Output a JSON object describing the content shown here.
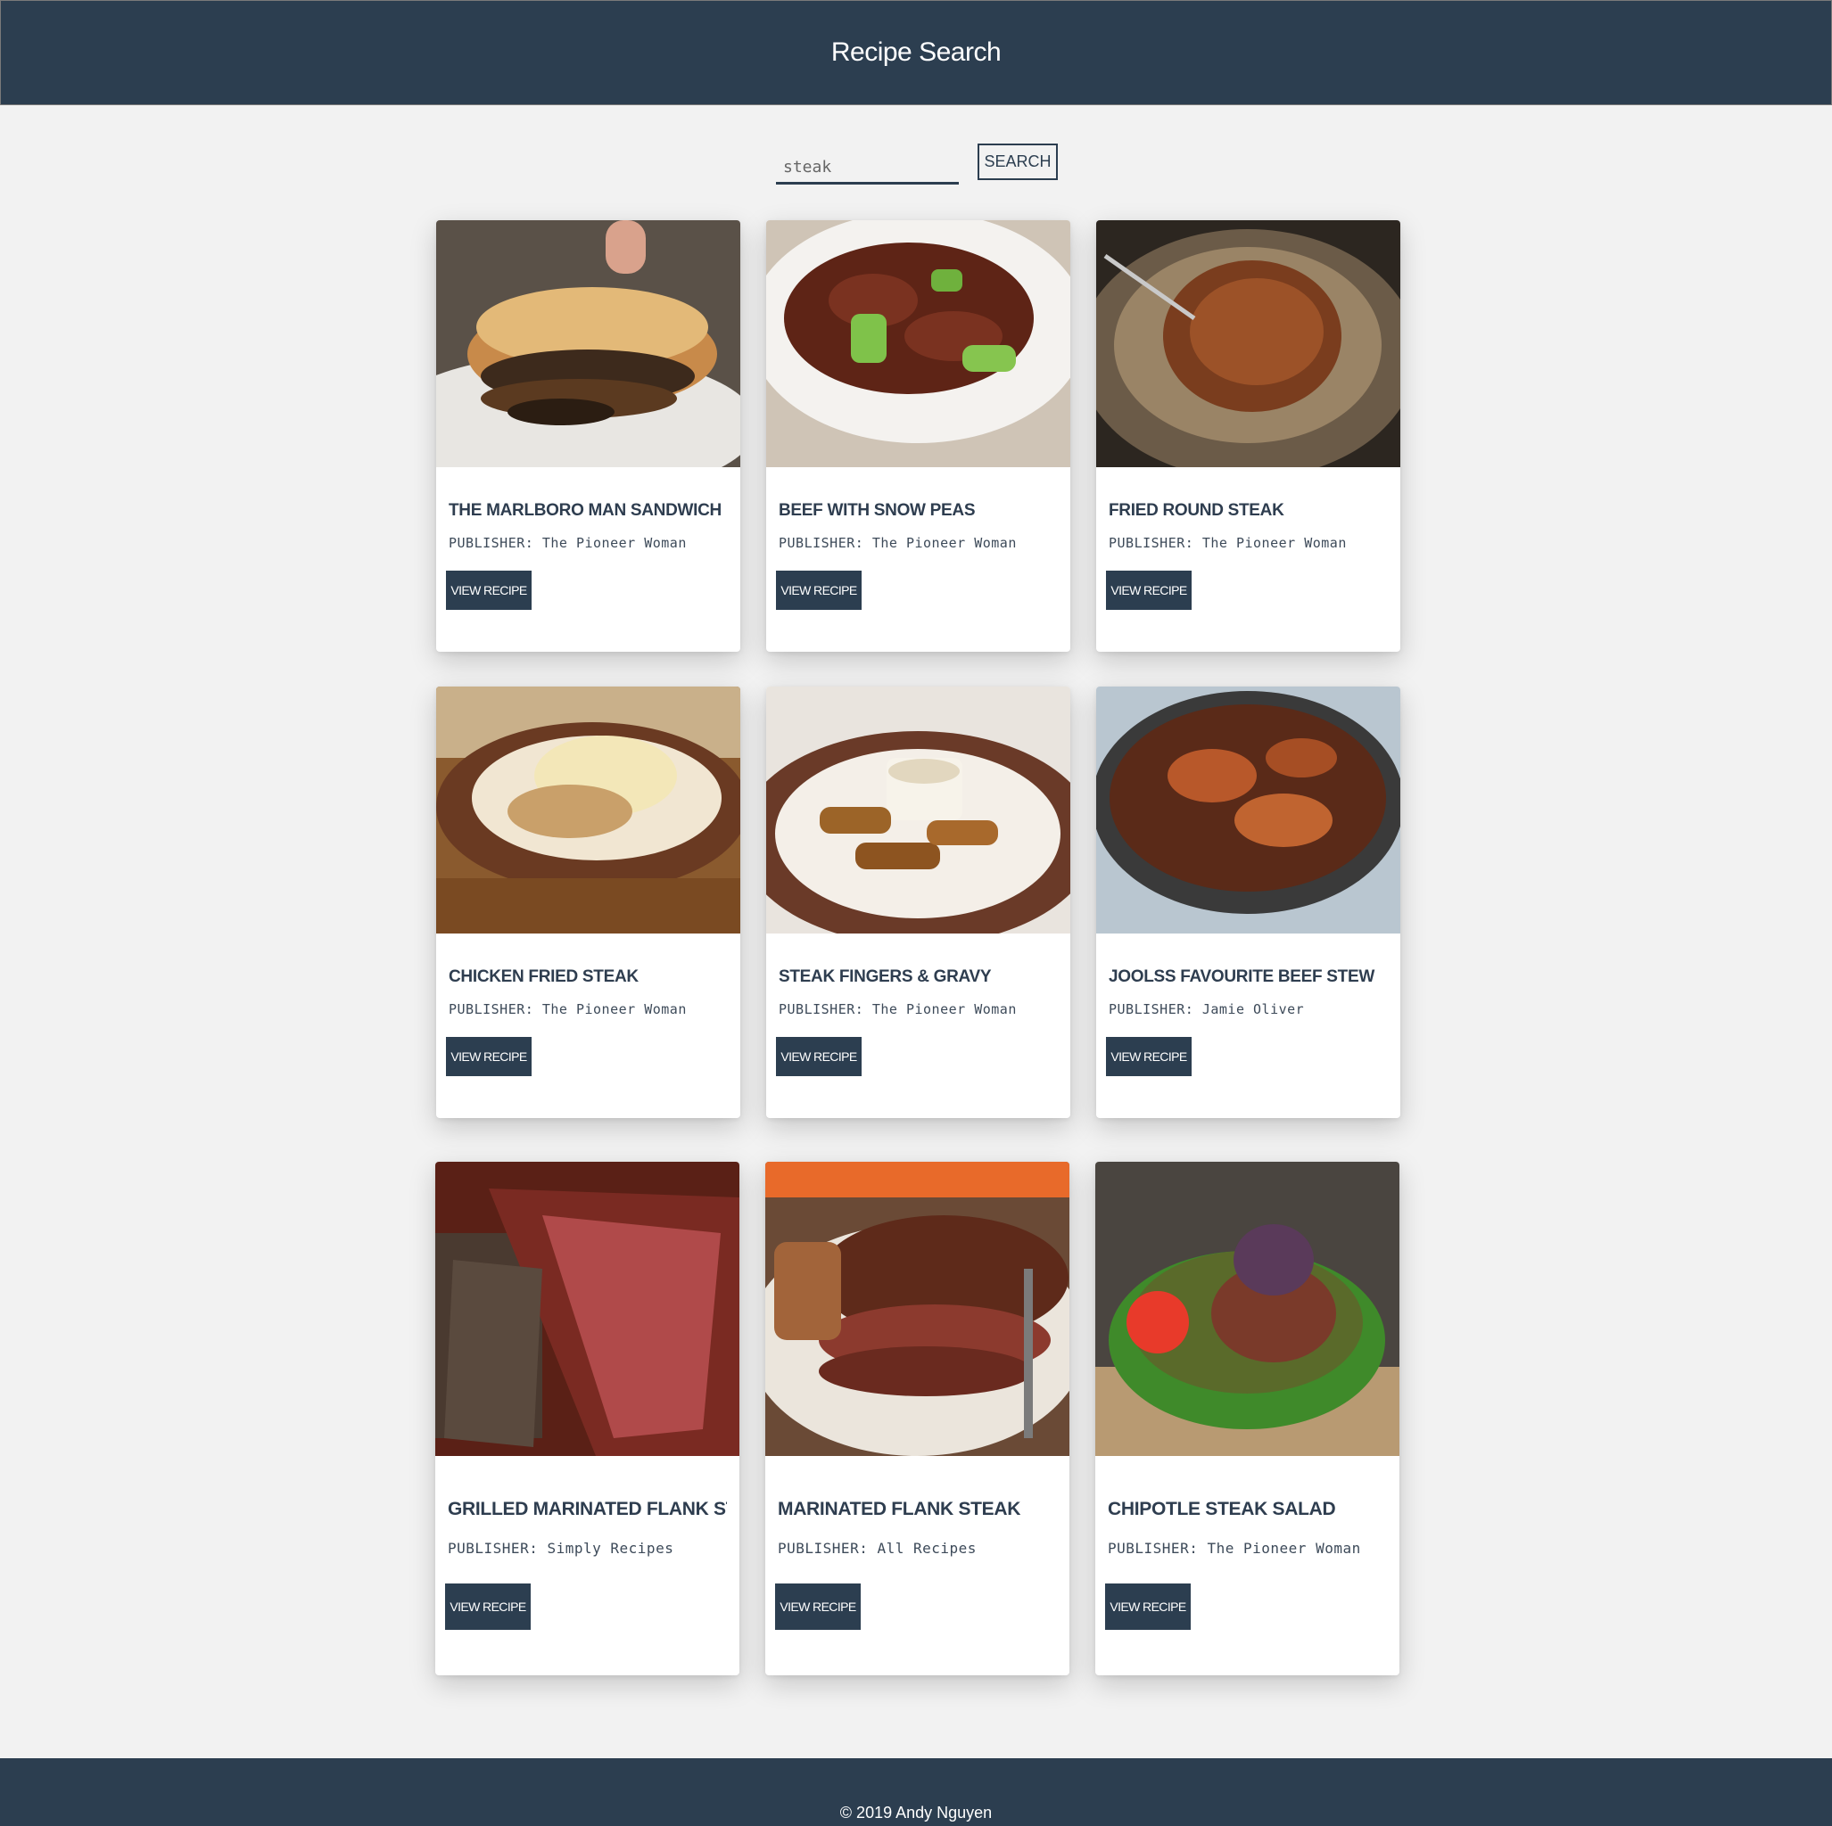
{
  "header": {
    "title": "Recipe Search"
  },
  "search": {
    "value": "steak",
    "button_label": "SEARCH"
  },
  "publisher_label": "PUBLISHER:",
  "recipes": [
    {
      "title": "THE MARLBORO MAN SANDWICH",
      "publisher": "The Pioneer Woman",
      "button_label": "VIEW RECIPE",
      "image": "sandwich-photo"
    },
    {
      "title": "BEEF WITH SNOW PEAS",
      "publisher": "The Pioneer Woman",
      "button_label": "VIEW RECIPE",
      "image": "beef-snow-peas-photo"
    },
    {
      "title": "FRIED ROUND STEAK",
      "publisher": "The Pioneer Woman",
      "button_label": "VIEW RECIPE",
      "image": "fried-steak-photo"
    },
    {
      "title": "CHICKEN FRIED STEAK",
      "publisher": "The Pioneer Woman",
      "button_label": "VIEW RECIPE",
      "image": "chicken-fried-steak-photo"
    },
    {
      "title": "STEAK FINGERS & GRAVY",
      "publisher": "The Pioneer Woman",
      "button_label": "VIEW RECIPE",
      "image": "steak-fingers-photo"
    },
    {
      "title": "JOOLSS FAVOURITE BEEF STEW",
      "publisher": "Jamie Oliver",
      "button_label": "VIEW RECIPE",
      "image": "beef-stew-photo"
    },
    {
      "title": "GRILLED MARINATED FLANK ST...",
      "publisher": "Simply Recipes",
      "button_label": "VIEW RECIPE",
      "image": "grilled-flank-photo"
    },
    {
      "title": "MARINATED FLANK STEAK",
      "publisher": "All Recipes",
      "button_label": "VIEW RECIPE",
      "image": "flank-steak-photo"
    },
    {
      "title": "CHIPOTLE STEAK SALAD",
      "publisher": "The Pioneer Woman",
      "button_label": "VIEW RECIPE",
      "image": "steak-salad-photo"
    }
  ],
  "footer": {
    "text": "© 2019 Andy Nguyen"
  },
  "colors": {
    "navy": "#2c3e50",
    "background": "#f2f2f2",
    "card": "#ffffff"
  }
}
